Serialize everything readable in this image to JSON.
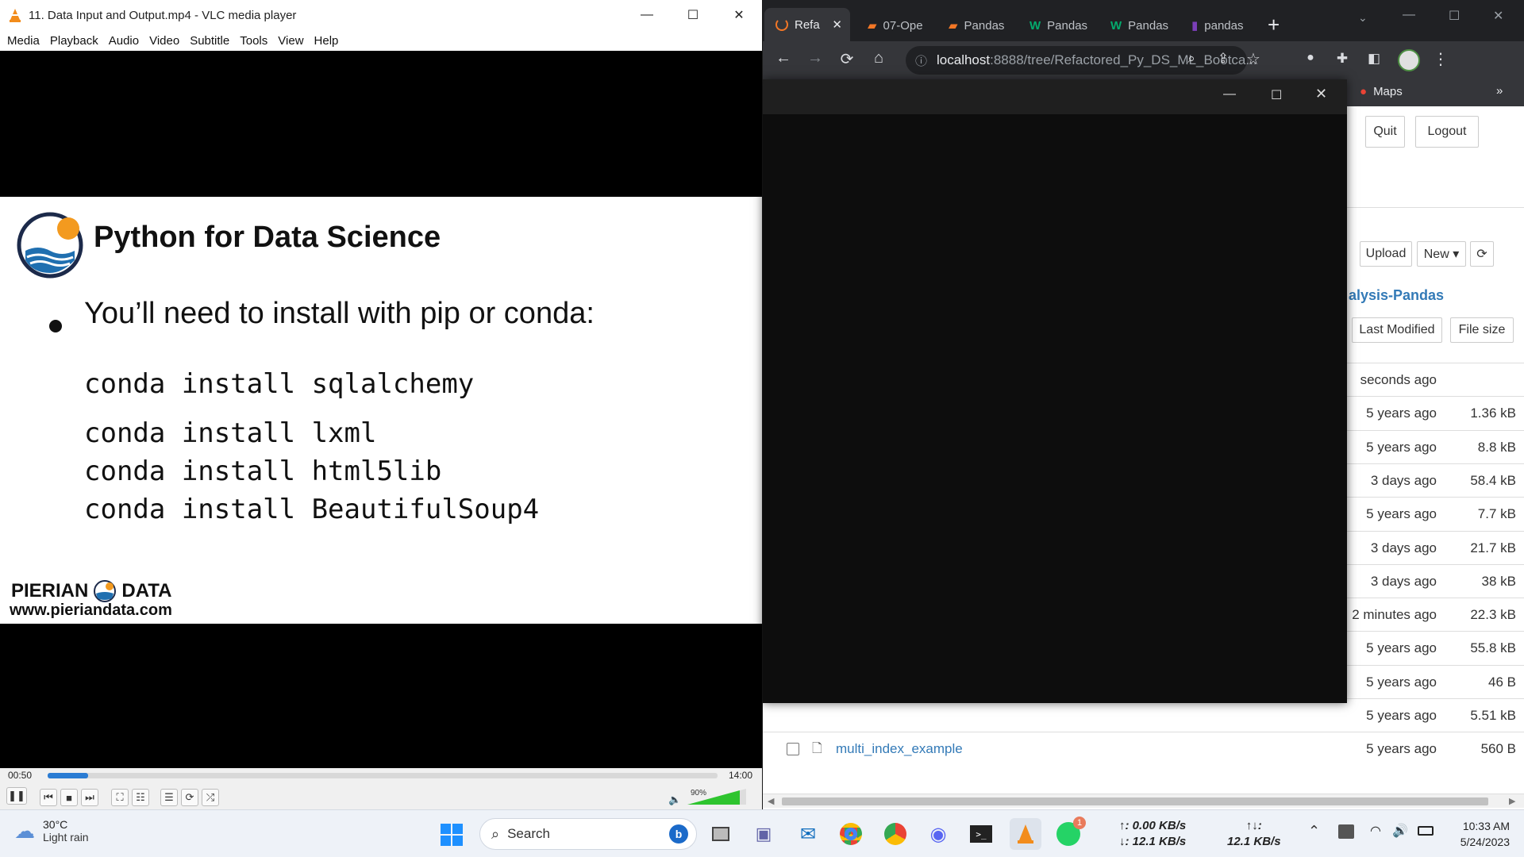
{
  "vlc": {
    "title": "11. Data Input and Output.mp4 - VLC media player",
    "menu": [
      "Media",
      "Playback",
      "Audio",
      "Video",
      "Subtitle",
      "Tools",
      "View",
      "Help"
    ],
    "slide": {
      "heading": "Python for Data Science",
      "bullet": "You’ll need to install with pip or conda:",
      "commands": [
        "conda install sqlalchemy",
        "conda install lxml",
        "conda install html5lib",
        "conda install BeautifulSoup4"
      ],
      "brand_left": "PIERIAN",
      "brand_right": "DATA",
      "brand_url": "www.pieriandata.com"
    },
    "time_elapsed": "00:50",
    "time_total": "14:00",
    "progress": 0.06,
    "volume_label": "90%",
    "volume": 0.9
  },
  "chrome": {
    "tabs": [
      {
        "label": "Refa",
        "active": true
      },
      {
        "label": "07-Ope",
        "active": false
      },
      {
        "label": "Pandas",
        "active": false
      },
      {
        "label": "Pandas",
        "active": false
      },
      {
        "label": "Pandas",
        "active": false
      },
      {
        "label": "pandas",
        "active": false
      }
    ],
    "url_host": "localhost",
    "url_rest": ":8888/tree/Refactored_Py_DS_ML_Bootca...",
    "bookmark": "Maps",
    "more": "»"
  },
  "jupyter": {
    "quit": "Quit",
    "logout": "Logout",
    "upload": "Upload",
    "new": "New ▾",
    "folder": "alysis-Pandas",
    "col_modified": "Last Modified",
    "col_size": "File size",
    "rows": [
      {
        "name": "",
        "modified": "seconds ago",
        "size": ""
      },
      {
        "name": "",
        "modified": "5 years ago",
        "size": "1.36 kB"
      },
      {
        "name": "",
        "modified": "5 years ago",
        "size": "8.8 kB"
      },
      {
        "name": "",
        "modified": "3 days ago",
        "size": "58.4 kB"
      },
      {
        "name": "",
        "modified": "5 years ago",
        "size": "7.7 kB"
      },
      {
        "name": "",
        "modified": "3 days ago",
        "size": "21.7 kB"
      },
      {
        "name": "",
        "modified": "3 days ago",
        "size": "38 kB"
      },
      {
        "name": "",
        "modified": "2 minutes ago",
        "size": "22.3 kB"
      },
      {
        "name": "",
        "modified": "5 years ago",
        "size": "55.8 kB"
      },
      {
        "name": "",
        "modified": "5 years ago",
        "size": "46 B"
      },
      {
        "name": "",
        "modified": "5 years ago",
        "size": "5.51 kB"
      },
      {
        "name": "multi_index_example",
        "modified": "5 years ago",
        "size": "560 B"
      }
    ]
  },
  "taskbar": {
    "weather_temp": "30°C",
    "weather_desc": "Light rain",
    "search": "Search",
    "net_up": "↑: 0.00 KB/s",
    "net_down": "↓: 12.1 KB/s",
    "net_total_label": "↑↓:",
    "net_total": "12.1 KB/s",
    "time": "10:33 AM",
    "date": "5/24/2023",
    "whatsapp_badge": "1"
  }
}
